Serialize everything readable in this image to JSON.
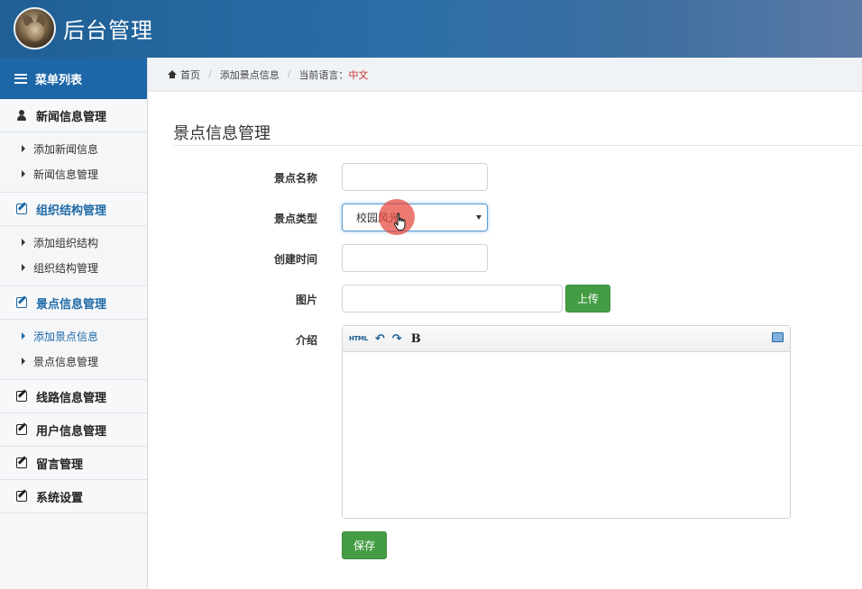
{
  "header": {
    "title": "后台管理"
  },
  "sidebar": {
    "heading": "菜单列表",
    "groups": [
      {
        "title": "新闻信息管理",
        "items": [
          "添加新闻信息",
          "新闻信息管理"
        ]
      },
      {
        "title": "组织结构管理",
        "items": [
          "添加组织结构",
          "组织结构管理"
        ]
      },
      {
        "title": "景点信息管理",
        "items": [
          "添加景点信息",
          "景点信息管理"
        ]
      },
      {
        "title": "线路信息管理",
        "items": []
      },
      {
        "title": "用户信息管理",
        "items": []
      },
      {
        "title": "留言管理",
        "items": []
      },
      {
        "title": "系统设置",
        "items": []
      }
    ]
  },
  "breadcrumb": {
    "home": "首页",
    "current": "添加景点信息",
    "language_label": "当前语言：",
    "language_value": "中文"
  },
  "page": {
    "title": "景点信息管理"
  },
  "form": {
    "name_label": "景点名称",
    "name_value": "",
    "type_label": "景点类型",
    "type_value": "校园风光",
    "created_label": "创建时间",
    "created_value": "",
    "image_label": "图片",
    "image_value": "",
    "upload_label": "上传",
    "intro_label": "介绍",
    "save_label": "保存"
  },
  "editor": {
    "html_tool": "HTML",
    "undo_tool": "↶",
    "redo_tool": "↷",
    "bold_tool": "B"
  },
  "colors": {
    "header_bg": "#2a6ea8",
    "sidebar_head_bg": "#1d67a8",
    "accent_blue": "#1f6aa6",
    "button_green": "#449d44",
    "language_red": "#c9302c"
  }
}
